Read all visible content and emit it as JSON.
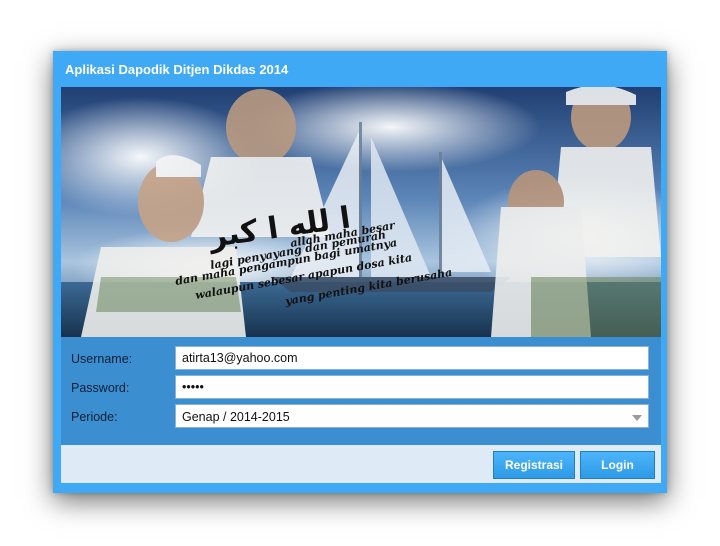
{
  "window": {
    "title": "Aplikasi Dapodik Ditjen Dikdas 2014"
  },
  "banner": {
    "caption_lines": [
      "allah maha besar",
      "lagi penyayang dan pemurah",
      "dan maha pengampun bagi umatnya",
      "walaupun sebesar apapun dosa kita",
      "yang penting kita berusaha"
    ]
  },
  "form": {
    "username_label": "Username:",
    "username_value": "atirta13@yahoo.com",
    "password_label": "Password:",
    "password_value": "•••••",
    "periode_label": "Periode:",
    "periode_value": "Genap / 2014-2015"
  },
  "footer": {
    "register_label": "Registrasi",
    "login_label": "Login"
  },
  "colors": {
    "window_blue": "#3fa9f5",
    "form_blue": "#3b8fd1",
    "footer_bg": "#deebf7"
  }
}
